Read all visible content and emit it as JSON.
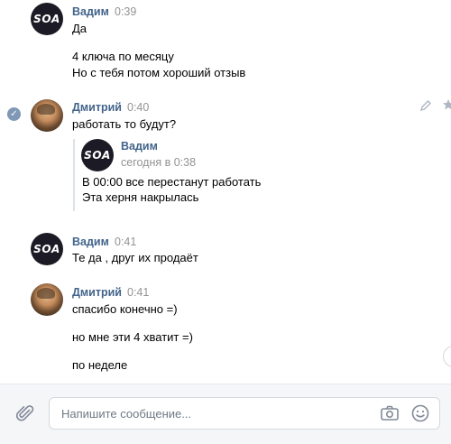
{
  "messages": [
    {
      "author": "Вадим",
      "time": "0:39",
      "lines": [
        "Да",
        "4 ключа по месяцу",
        "Но с тебя потом хороший отзыв"
      ]
    },
    {
      "author": "Дмитрий",
      "time": "0:40",
      "lines": [
        "работать то будут?"
      ],
      "quote": {
        "author": "Вадим",
        "date": "сегодня в 0:38",
        "lines": [
          "В 00:00 все перестанут работать",
          "Эта херня накрылась"
        ]
      }
    },
    {
      "author": "Вадим",
      "time": "0:41",
      "lines": [
        "Те да , друг их продаёт"
      ]
    },
    {
      "author": "Дмитрий",
      "time": "0:41",
      "lines": [
        "спасибо конечно =)",
        "но мне эти 4 хватит =)",
        "по неделе"
      ]
    }
  ],
  "avatar_text": "SOA",
  "composer": {
    "placeholder": "Напишите сообщение..."
  },
  "icons": {
    "attach": "paperclip-icon",
    "camera": "camera-icon",
    "emoji": "smile-icon",
    "edit": "pencil-icon",
    "star": "star-icon",
    "read": "check-circle-icon"
  },
  "colors": {
    "author": "#42648b",
    "time": "#939393",
    "composer_bg": "#f5f6f8",
    "border": "#d3d9de"
  }
}
